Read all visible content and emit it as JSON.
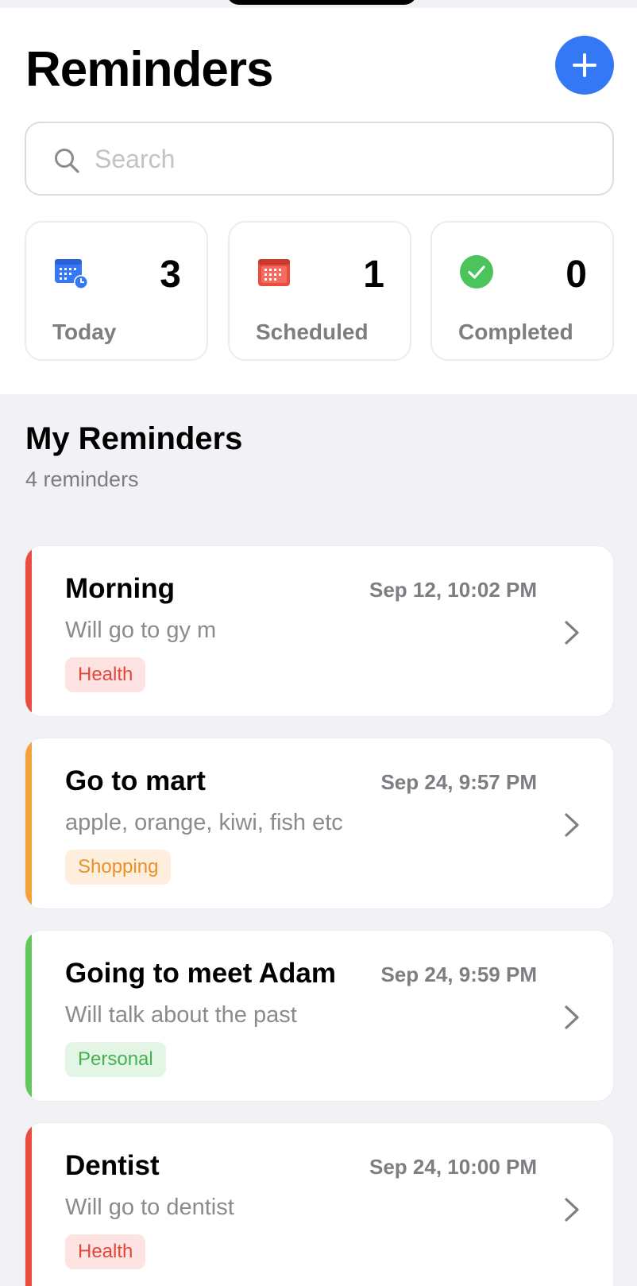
{
  "header": {
    "title": "Reminders",
    "add_icon": "plus-icon"
  },
  "search": {
    "placeholder": "Search",
    "icon": "search-icon"
  },
  "stats": [
    {
      "label": "Today",
      "count": "3",
      "icon": "calendar-clock-icon",
      "color": "#3478f6"
    },
    {
      "label": "Scheduled",
      "count": "1",
      "icon": "calendar-icon",
      "color": "#ea4c3e"
    },
    {
      "label": "Completed",
      "count": "0",
      "icon": "checkmark-circle-icon",
      "color": "#4cc45c"
    }
  ],
  "section": {
    "title": "My Reminders",
    "subtitle": "4 reminders"
  },
  "reminders": [
    {
      "title": "Morning",
      "date": "Sep 12, 10:02 PM",
      "description": "Will go to gy m",
      "tag": "Health",
      "accent": "#ea4c3e",
      "tag_bg": "#fde4e2",
      "tag_color": "#e4453a"
    },
    {
      "title": "Go to mart",
      "date": "Sep 24, 9:57 PM",
      "description": "apple, orange, kiwi, fish etc",
      "tag": "Shopping",
      "accent": "#f4a23a",
      "tag_bg": "#fdefdc",
      "tag_color": "#e8902a"
    },
    {
      "title": "Going to meet Adam",
      "date": "Sep 24, 9:59 PM",
      "description": "Will talk about the past",
      "tag": "Personal",
      "accent": "#62c85e",
      "tag_bg": "#e3f5e4",
      "tag_color": "#44b24f"
    },
    {
      "title": "Dentist",
      "date": "Sep 24, 10:00 PM",
      "description": "Will go to dentist",
      "tag": "Health",
      "accent": "#ea4c3e",
      "tag_bg": "#fde4e2",
      "tag_color": "#e4453a"
    }
  ]
}
